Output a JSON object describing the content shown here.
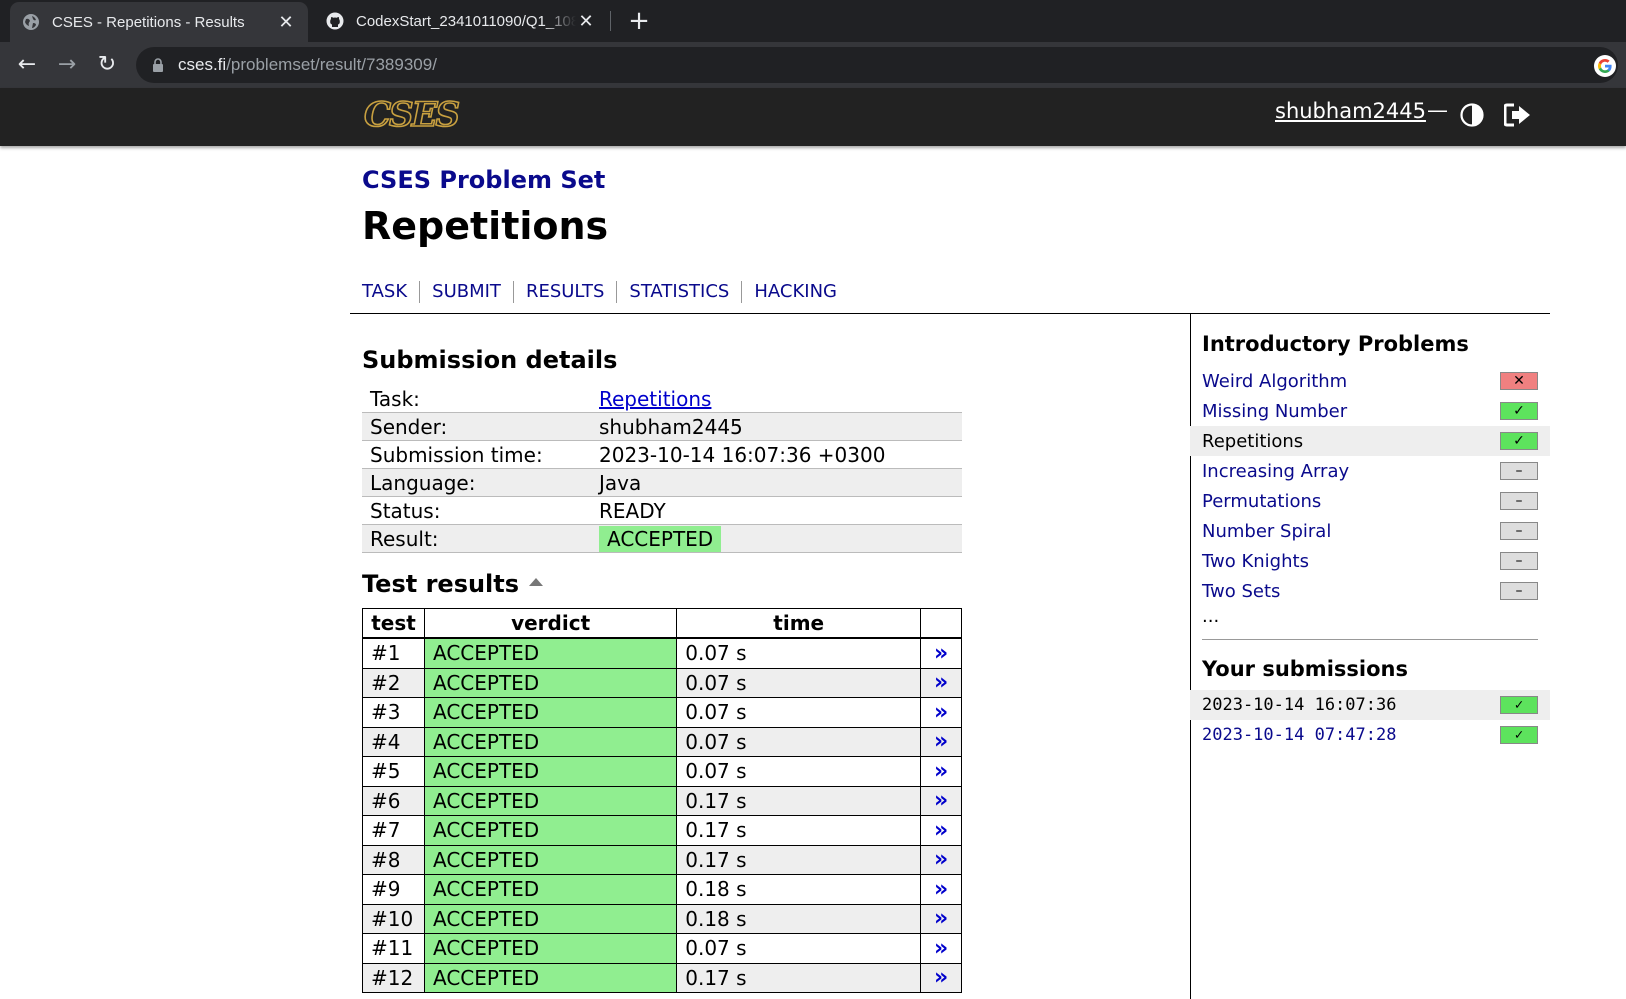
{
  "browser": {
    "tabs": [
      {
        "title": "CSES - Repetitions - Results",
        "active": true
      },
      {
        "title": "CodexStart_2341011090/Q1_108",
        "active": false
      }
    ],
    "url_host": "cses.fi",
    "url_path": "/problemset/result/7389309/"
  },
  "header": {
    "logo": "CSES",
    "username": "shubham2445",
    "separator": "—"
  },
  "page": {
    "problemset": "CSES Problem Set",
    "title": "Repetitions",
    "nav": [
      "TASK",
      "SUBMIT",
      "RESULTS",
      "STATISTICS",
      "HACKING"
    ]
  },
  "submission": {
    "heading": "Submission details",
    "rows": [
      {
        "key": "Task:",
        "value": "Repetitions"
      },
      {
        "key": "Sender:",
        "value": "shubham2445"
      },
      {
        "key": "Submission time:",
        "value": "2023-10-14 16:07:36 +0300"
      },
      {
        "key": "Language:",
        "value": "Java"
      },
      {
        "key": "Status:",
        "value": "READY"
      },
      {
        "key": "Result:",
        "value": "ACCEPTED"
      }
    ]
  },
  "tests": {
    "heading": "Test results",
    "columns": [
      "test",
      "verdict",
      "time",
      ""
    ],
    "link_glyph": "»",
    "rows": [
      {
        "test": "#1",
        "verdict": "ACCEPTED",
        "time": "0.07 s"
      },
      {
        "test": "#2",
        "verdict": "ACCEPTED",
        "time": "0.07 s"
      },
      {
        "test": "#3",
        "verdict": "ACCEPTED",
        "time": "0.07 s"
      },
      {
        "test": "#4",
        "verdict": "ACCEPTED",
        "time": "0.07 s"
      },
      {
        "test": "#5",
        "verdict": "ACCEPTED",
        "time": "0.07 s"
      },
      {
        "test": "#6",
        "verdict": "ACCEPTED",
        "time": "0.17 s"
      },
      {
        "test": "#7",
        "verdict": "ACCEPTED",
        "time": "0.17 s"
      },
      {
        "test": "#8",
        "verdict": "ACCEPTED",
        "time": "0.17 s"
      },
      {
        "test": "#9",
        "verdict": "ACCEPTED",
        "time": "0.18 s"
      },
      {
        "test": "#10",
        "verdict": "ACCEPTED",
        "time": "0.18 s"
      },
      {
        "test": "#11",
        "verdict": "ACCEPTED",
        "time": "0.07 s"
      },
      {
        "test": "#12",
        "verdict": "ACCEPTED",
        "time": "0.17 s"
      }
    ]
  },
  "sidebar": {
    "section_title": "Introductory Problems",
    "problems": [
      {
        "name": "Weird Algorithm",
        "status": "fail",
        "current": false
      },
      {
        "name": "Missing Number",
        "status": "ok",
        "current": false
      },
      {
        "name": "Repetitions",
        "status": "ok",
        "current": true
      },
      {
        "name": "Increasing Array",
        "status": "none",
        "current": false
      },
      {
        "name": "Permutations",
        "status": "none",
        "current": false
      },
      {
        "name": "Number Spiral",
        "status": "none",
        "current": false
      },
      {
        "name": "Two Knights",
        "status": "none",
        "current": false
      },
      {
        "name": "Two Sets",
        "status": "none",
        "current": false
      }
    ],
    "more": "...",
    "submissions_title": "Your submissions",
    "submissions": [
      {
        "time": "2023-10-14 16:07:36",
        "status": "ok",
        "current": true
      },
      {
        "time": "2023-10-14 07:47:28",
        "status": "ok",
        "current": false
      }
    ]
  },
  "colors": {
    "accepted": "#90ee90",
    "ok_badge": "#5de35d",
    "fail_badge": "#f08080",
    "link": "#0a0a8c"
  }
}
